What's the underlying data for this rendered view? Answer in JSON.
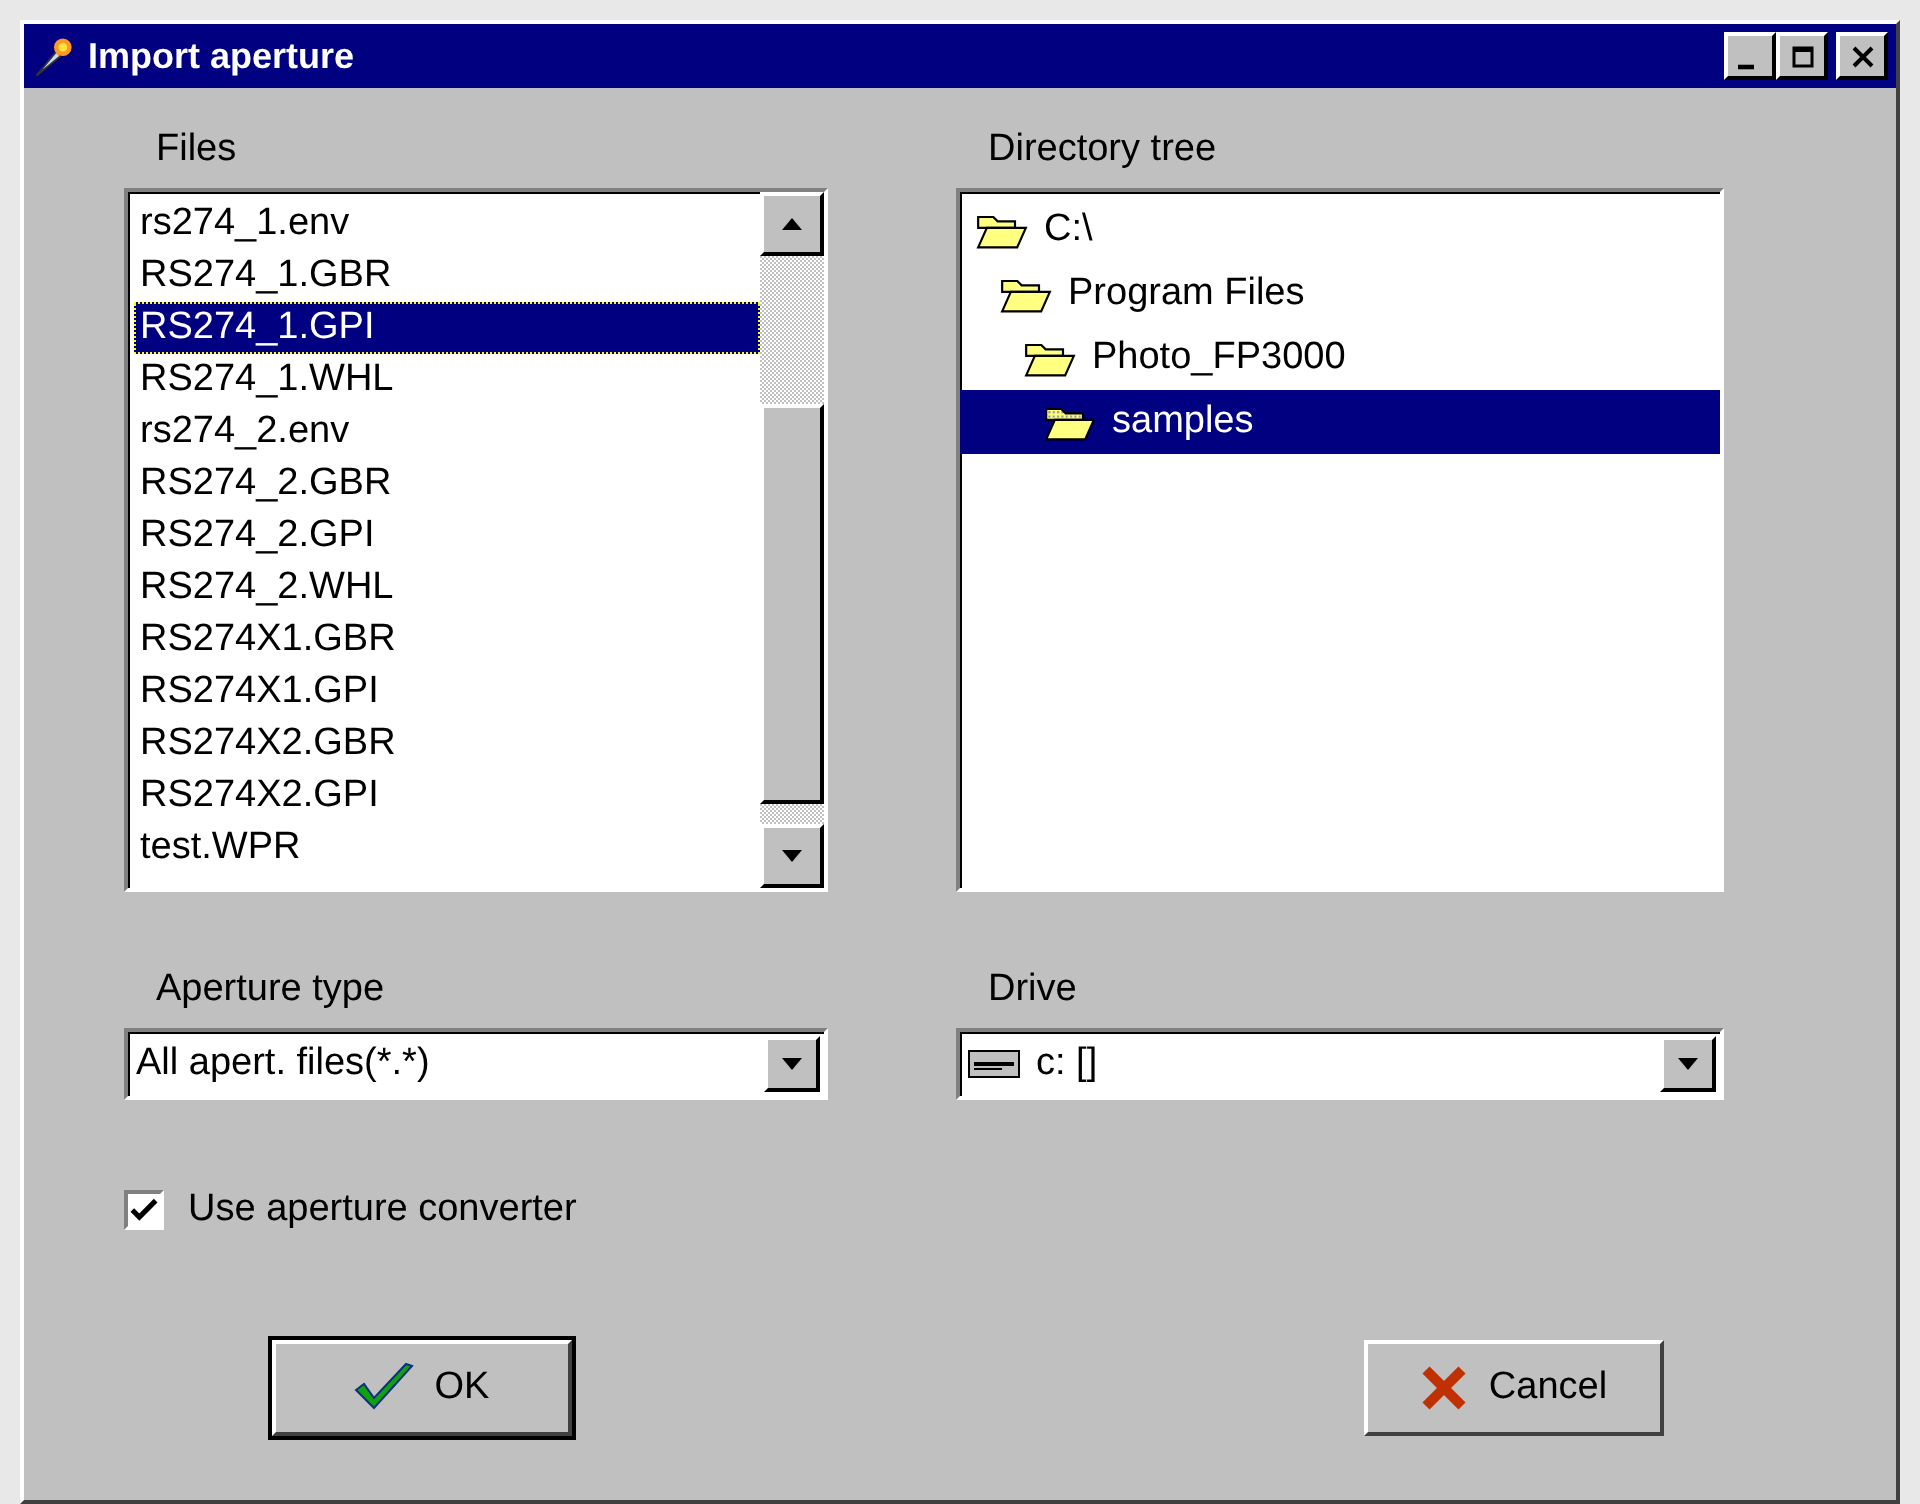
{
  "window": {
    "title": "Import aperture"
  },
  "files": {
    "label": "Files",
    "items": [
      {
        "name": "rs274_1.env",
        "selected": false
      },
      {
        "name": "RS274_1.GBR",
        "selected": false
      },
      {
        "name": "RS274_1.GPI",
        "selected": true
      },
      {
        "name": "RS274_1.WHL",
        "selected": false
      },
      {
        "name": "rs274_2.env",
        "selected": false
      },
      {
        "name": "RS274_2.GBR",
        "selected": false
      },
      {
        "name": "RS274_2.GPI",
        "selected": false
      },
      {
        "name": "RS274_2.WHL",
        "selected": false
      },
      {
        "name": "RS274X1.GBR",
        "selected": false
      },
      {
        "name": "RS274X1.GPI",
        "selected": false
      },
      {
        "name": "RS274X2.GBR",
        "selected": false
      },
      {
        "name": "RS274X2.GPI",
        "selected": false
      },
      {
        "name": "test.WPR",
        "selected": false
      }
    ]
  },
  "directory_tree": {
    "label": "Directory tree",
    "items": [
      {
        "name": "C:\\",
        "selected": false,
        "children": [
          {
            "name": "Program Files",
            "selected": false,
            "children": [
              {
                "name": "Photo_FP3000",
                "selected": false,
                "children": [
                  {
                    "name": "samples",
                    "selected": true
                  }
                ]
              }
            ]
          }
        ]
      }
    ]
  },
  "aperture_type": {
    "label": "Aperture type",
    "value": "All apert. files(*.*)"
  },
  "drive": {
    "label": "Drive",
    "value": "c: []"
  },
  "use_converter": {
    "label": "Use aperture converter",
    "checked": true
  },
  "buttons": [
    {
      "kind": "ok",
      "label": "OK"
    },
    {
      "kind": "cancel",
      "label": "Cancel"
    }
  ]
}
